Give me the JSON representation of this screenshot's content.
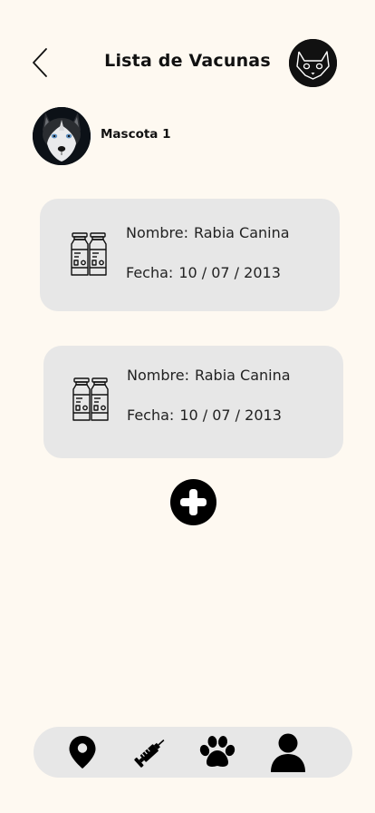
{
  "header": {
    "title": "Lista de Vacunas",
    "back_icon": "chevron-left-icon",
    "logo_icon": "cat-face-logo-icon"
  },
  "pet": {
    "name": "Mascota 1",
    "avatar": "husky-photo"
  },
  "vaccines": [
    {
      "name_label": "Nombre:",
      "name_value": "Rabia Canina",
      "date_label": "Fecha:",
      "date_value": "10 / 07 / 2013",
      "icon": "vaccine-vials-icon"
    },
    {
      "name_label": "Nombre:",
      "name_value": "Rabia Canina",
      "date_label": "Fecha:",
      "date_value": "10 / 07 / 2013",
      "icon": "vaccine-vials-icon"
    }
  ],
  "add_button": {
    "icon": "plus-circle-icon"
  },
  "bottom_nav": {
    "items": [
      {
        "id": "map",
        "icon": "location-pin-icon"
      },
      {
        "id": "vaccines",
        "icon": "syringe-icon"
      },
      {
        "id": "pets",
        "icon": "paw-icon"
      },
      {
        "id": "profile",
        "icon": "user-icon"
      }
    ]
  },
  "colors": {
    "background": "#FEF9F1",
    "card": "#E7E7E7",
    "foreground": "#111111"
  }
}
